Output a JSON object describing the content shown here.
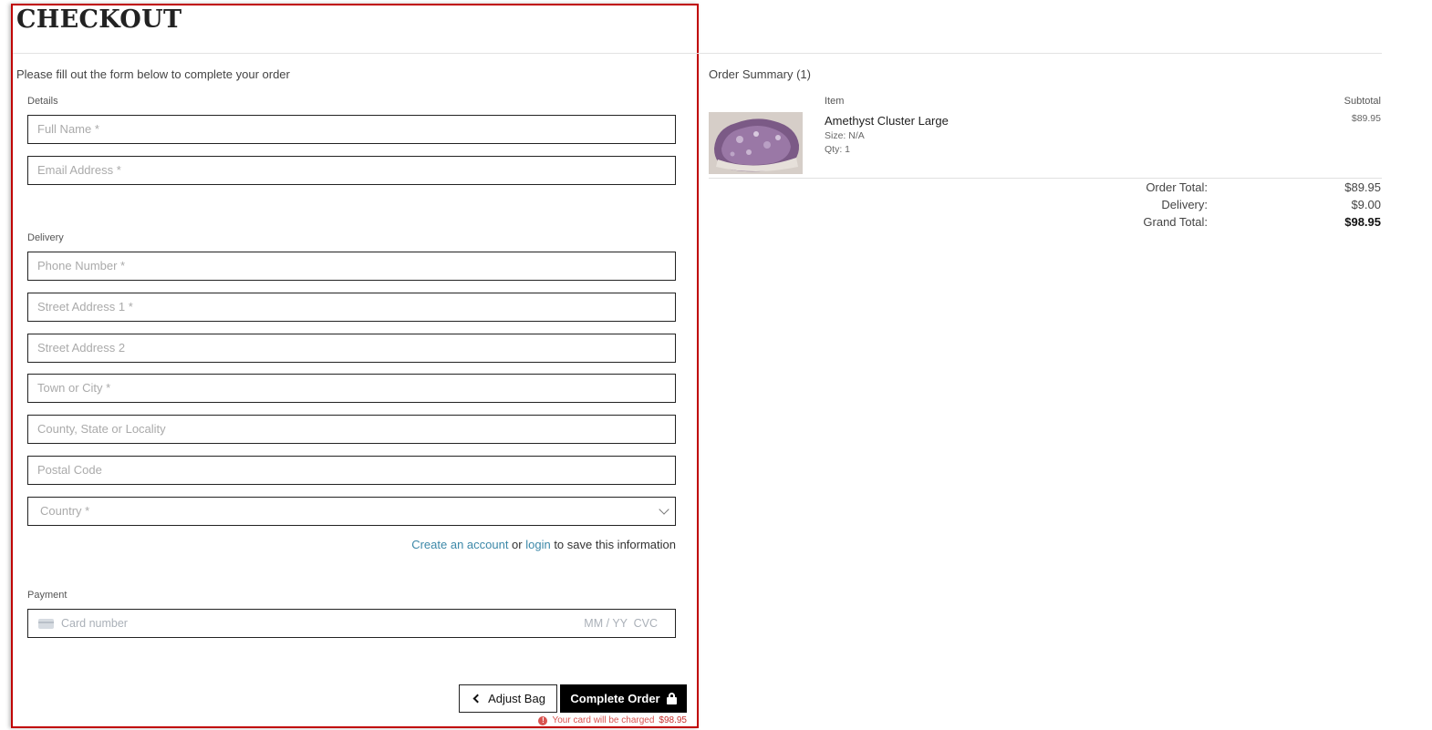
{
  "page": {
    "title": "CHECKOUT",
    "intro": "Please fill out the form below to complete your order"
  },
  "form": {
    "details_label": "Details",
    "full_name_placeholder": "Full Name *",
    "email_placeholder": "Email Address *",
    "delivery_label": "Delivery",
    "phone_placeholder": "Phone Number *",
    "street1_placeholder": "Street Address 1 *",
    "street2_placeholder": "Street Address 2",
    "town_placeholder": "Town or City *",
    "county_placeholder": "County, State or Locality",
    "postcode_placeholder": "Postal Code",
    "country_selected": "Country *",
    "save_info": {
      "create_account": "Create an account",
      "or": " or ",
      "login": "login",
      "suffix": " to save this information"
    },
    "payment_label": "Payment",
    "card": {
      "number_placeholder": "Card number",
      "expiry_placeholder": "MM / YY",
      "cvc_placeholder": "CVC"
    },
    "adjust_bag_label": "Adjust Bag",
    "complete_order_label": "Complete Order",
    "charge_note_prefix": "Your card will be charged",
    "charge_amount": "$98.95"
  },
  "summary": {
    "title": "Order Summary (1)",
    "col_item": "Item",
    "col_subtotal": "Subtotal",
    "items": [
      {
        "name": "Amethyst Cluster Large",
        "size": "Size: N/A",
        "qty": "Qty: 1",
        "price": "$89.95"
      }
    ],
    "order_total_label": "Order Total:",
    "order_total": "$89.95",
    "delivery_label": "Delivery:",
    "delivery": "$9.00",
    "grand_total_label": "Grand Total:",
    "grand_total": "$98.95"
  },
  "colors": {
    "highlight_border": "#c00000",
    "link": "#3c88a8",
    "error": "#d9534f",
    "primary_button": "#000000"
  }
}
